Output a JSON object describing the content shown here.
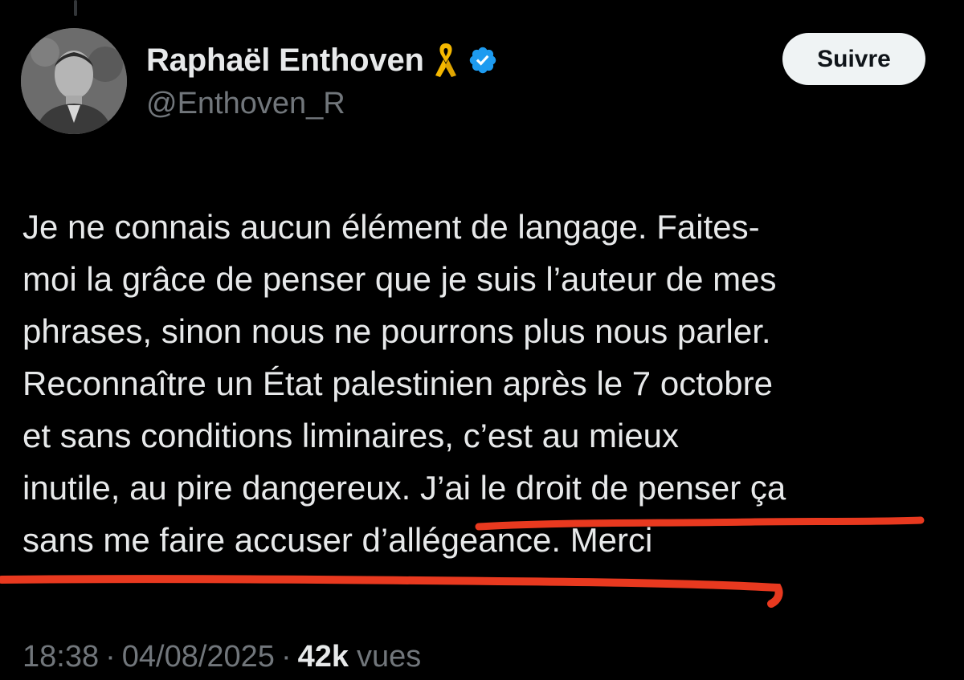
{
  "author": {
    "display_name": "Raphaël Enthoven",
    "handle": "@Enthoven_R",
    "avatar_icon": "profile-photo",
    "badges": [
      "yellow-ribbon-icon",
      "verified-badge-icon"
    ]
  },
  "follow_button": {
    "label": "Suivre"
  },
  "tweet": {
    "lines": [
      "Je ne connais aucun élément de langage. Faites-",
      "moi la grâce de penser que je suis l’auteur de mes",
      "phrases, sinon nous ne pourrons plus nous parler.",
      "Reconnaître un État palestinien après le 7 octobre",
      "et sans conditions liminaires, c’est au mieux",
      "inutile, au pire dangereux. J’ai le droit de penser ça",
      "sans me faire accuser d’allégeance. Merci"
    ]
  },
  "meta": {
    "time": "18:38",
    "separator": "·",
    "date": "04/08/2025",
    "views_count": "42k",
    "views_label": "vues"
  },
  "colors": {
    "background": "#000000",
    "text": "#e7e9ea",
    "secondary_text": "#71767b",
    "verified": "#1d9bf0",
    "ribbon": "#f5b800",
    "annotation_underline": "#e8391f"
  }
}
